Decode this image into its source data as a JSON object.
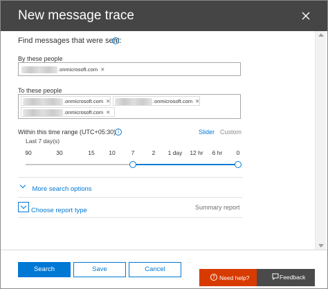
{
  "header": {
    "title": "New message trace",
    "close_icon": "close-icon"
  },
  "form": {
    "section_title": "Find messages that were sent:",
    "by_people": {
      "label": "By these people",
      "tokens": [
        ".onmicrosoft.com"
      ]
    },
    "to_people": {
      "label": "To these people",
      "tokens": [
        ".onmicrosoft.com",
        ".onmicrosoft.com",
        ".onmicrosoft.com"
      ]
    },
    "time_range": {
      "label": "Within this time range (UTC+05:30)",
      "slider_tab": "Slider",
      "custom_tab": "Custom",
      "current_value": "Last 7 day(s)",
      "ticks": [
        "90",
        "30",
        "15",
        "10",
        "7",
        "2",
        "1 day",
        "12 hr",
        "6 hr",
        "0"
      ],
      "selected_start": "7",
      "selected_end": "0"
    },
    "more_options": "More search options",
    "report_type_label": "Choose report type",
    "report_type_value": "Summary report"
  },
  "footer": {
    "search_label": "Search",
    "save_label": "Save",
    "cancel_label": "Cancel",
    "help_label": "Need help?",
    "feedback_label": "Feedback"
  },
  "colors": {
    "header_bg": "#454545",
    "accent": "#0078d4",
    "help_bg": "#d83b01",
    "feedback_bg": "#4a4a4a"
  }
}
